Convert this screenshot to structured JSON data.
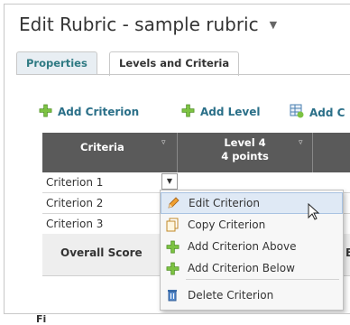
{
  "window": {
    "title": "Edit Rubric - sample rubric"
  },
  "tabs": [
    {
      "label": "Properties"
    },
    {
      "label": "Levels and Criteria"
    }
  ],
  "toolbar": {
    "add_criterion": "Add Criterion",
    "add_level": "Add Level",
    "add_c": "Add C"
  },
  "grid": {
    "criteria_header": "Criteria",
    "level_header": {
      "name": "Level 4",
      "points": "4 points"
    },
    "rows": [
      "Criterion 1",
      "Criterion 2",
      "Criterion 3"
    ],
    "overall_score": "Overall Score",
    "overall_cut": "B"
  },
  "context_menu": {
    "items": [
      {
        "label": "Edit Criterion",
        "icon": "pencil-icon"
      },
      {
        "label": "Copy Criterion",
        "icon": "copy-icon"
      },
      {
        "label": "Add Criterion Above",
        "icon": "plus-icon"
      },
      {
        "label": "Add Criterion Below",
        "icon": "plus-icon"
      },
      {
        "label": "Delete Criterion",
        "icon": "trash-icon"
      }
    ]
  },
  "colors": {
    "accent_teal": "#2a6f88",
    "header_gray": "#5a5a5a",
    "plus_green": "#7cc242",
    "highlight": "#dfe9f5"
  },
  "footer_caption": "Fi"
}
